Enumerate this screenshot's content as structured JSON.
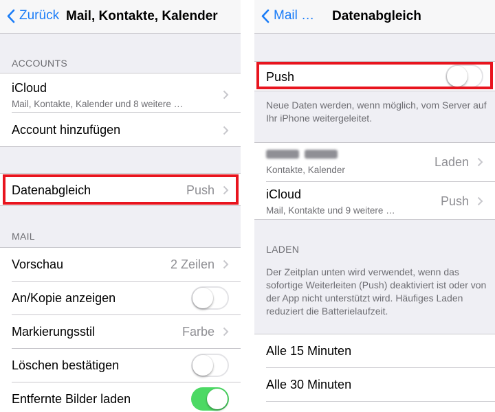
{
  "left": {
    "nav": {
      "back_label": "Zurück",
      "title": "Mail, Kontakte, Kalender"
    },
    "accounts_header": "ACCOUNTS",
    "icloud": {
      "label": "iCloud",
      "subtitle": "Mail, Kontakte, Kalender und 8 weitere …"
    },
    "add_account": {
      "label": "Account hinzufügen"
    },
    "fetch": {
      "label": "Datenabgleich",
      "value": "Push"
    },
    "mail_header": "MAIL",
    "mail_rows": {
      "preview": {
        "label": "Vorschau",
        "value": "2 Zeilen"
      },
      "show_cc": {
        "label": "An/Kopie anzeigen",
        "on": false
      },
      "flag_style": {
        "label": "Markierungsstil",
        "value": "Farbe"
      },
      "ask_delete": {
        "label": "Löschen bestätigen",
        "on": false
      },
      "load_images": {
        "label": "Entfernte Bilder laden",
        "on": true
      }
    }
  },
  "right": {
    "nav": {
      "back_label": "Mail …",
      "title": "Datenabgleich"
    },
    "push": {
      "label": "Push",
      "on": false
    },
    "push_footer": "Neue Daten werden, wenn möglich, vom Server auf Ihr iPhone weitergeleitet.",
    "account1": {
      "subtitle": "Kontakte, Kalender",
      "value": "Laden"
    },
    "account2": {
      "label": "iCloud",
      "subtitle": "Mail, Kontakte und 9 weitere …",
      "value": "Push"
    },
    "fetch_header": "LADEN",
    "fetch_footer": "Der Zeitplan unten wird verwendet, wenn das sofortige Weiterleiten (Push) deaktiviert ist oder von der App nicht unterstützt wird. Häufiges Laden reduziert die Batterielaufzeit.",
    "intervals": [
      "Alle 15 Minuten",
      "Alle 30 Minuten"
    ]
  },
  "colors": {
    "accent": "#1a7cf7",
    "highlight": "#e8141e",
    "toggle_on": "#4cd964",
    "background": "#efeff4"
  }
}
